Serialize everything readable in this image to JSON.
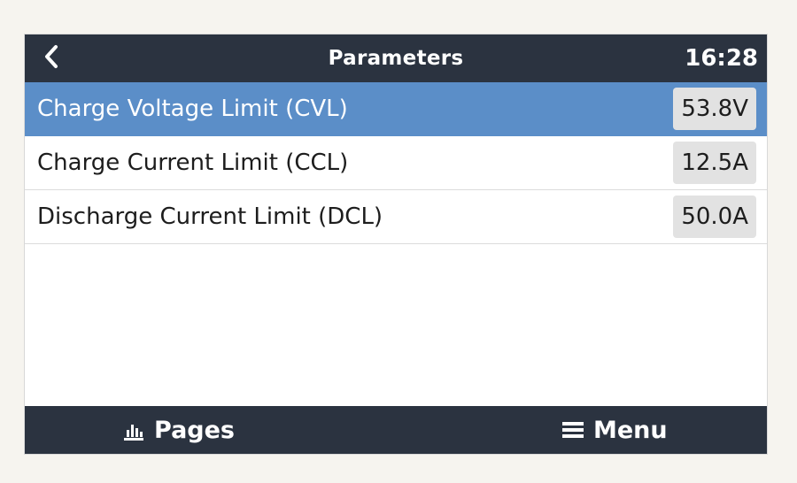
{
  "header": {
    "title": "Parameters",
    "clock": "16:28",
    "back_icon": "chevron-left-icon"
  },
  "parameters": [
    {
      "label": "Charge Voltage Limit (CVL)",
      "value": "53.8V",
      "selected": true
    },
    {
      "label": "Charge Current Limit (CCL)",
      "value": "12.5A",
      "selected": false
    },
    {
      "label": "Discharge Current Limit (DCL)",
      "value": "50.0A",
      "selected": false
    }
  ],
  "footer": {
    "pages_label": "Pages",
    "pages_icon": "bar-chart-icon",
    "menu_label": "Menu",
    "menu_icon": "hamburger-menu-icon"
  },
  "colors": {
    "bar_background": "#2b3340",
    "selected_row": "#5b8ec8",
    "value_box": "#e2e2e2"
  }
}
